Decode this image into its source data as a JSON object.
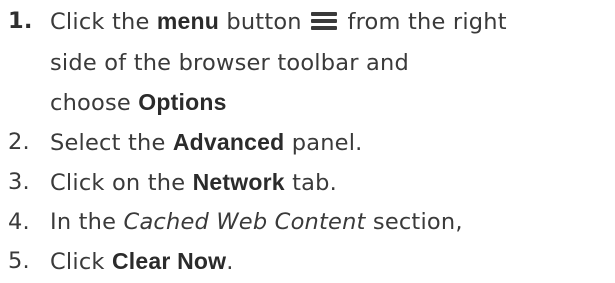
{
  "steps": [
    {
      "number": "1.",
      "line1_pre": "Click the ",
      "line1_bold": "menu",
      "line1_mid": " button ",
      "icon": "hamburger-menu-icon",
      "line1_post": " from the right",
      "line2": "side of the browser toolbar and",
      "line3_pre": "choose ",
      "line3_bold": "Options"
    },
    {
      "number": "2.",
      "pre": "Select the ",
      "bold": "Advanced",
      "post": " panel."
    },
    {
      "number": "3.",
      "pre": "Click on the ",
      "bold": "Network",
      "post": " tab."
    },
    {
      "number": "4.",
      "pre": "In the ",
      "italic": "Cached Web Content",
      "post": " section,"
    },
    {
      "number": "5.",
      "pre": "Click ",
      "bold": "Clear Now",
      "post": "."
    }
  ],
  "colors": {
    "text": "#3a3a3a",
    "bold_text": "#2b2b2b",
    "icon": "#3a3a3a"
  }
}
